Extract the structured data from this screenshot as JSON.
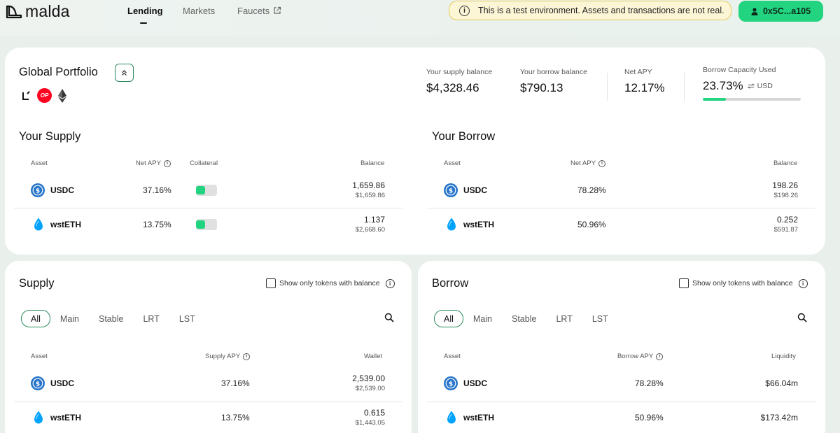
{
  "app": {
    "logo_text": "malda"
  },
  "nav": {
    "lending": "Lending",
    "markets": "Markets",
    "faucets": "Faucets"
  },
  "banner": {
    "text": "This is a test environment. Assets and transactions are not real."
  },
  "wallet": {
    "address": "0x5C...a105"
  },
  "portfolio": {
    "title": "Global Portfolio",
    "chains": [
      "linea-icon",
      "optimism-icon",
      "ethereum-icon"
    ],
    "op_label": "OP",
    "supply_balance_label": "Your supply balance",
    "supply_balance": "$4,328.46",
    "borrow_balance_label": "Your borrow balance",
    "borrow_balance": "$790.13",
    "net_apy_label": "Net APY",
    "net_apy": "12.17%",
    "capacity_label": "Borrow Capacity Used",
    "capacity_value": "23.73%",
    "capacity_unit": "USD",
    "capacity_fraction": 0.2373
  },
  "your_supply": {
    "title": "Your Supply",
    "headers": {
      "asset": "Asset",
      "net_apy": "Net APY",
      "collateral": "Collateral",
      "balance": "Balance"
    },
    "rows": [
      {
        "asset": "USDC",
        "apy": "37.16%",
        "collateral": true,
        "balance": "1,659.86",
        "balance_usd": "$1,659.86"
      },
      {
        "asset": "wstETH",
        "apy": "13.75%",
        "collateral": true,
        "balance": "1.137",
        "balance_usd": "$2,668.60"
      }
    ]
  },
  "your_borrow": {
    "title": "Your Borrow",
    "headers": {
      "asset": "Asset",
      "net_apy": "Net APY",
      "balance": "Balance"
    },
    "rows": [
      {
        "asset": "USDC",
        "apy": "78.28%",
        "balance": "198.26",
        "balance_usd": "$198.26"
      },
      {
        "asset": "wstETH",
        "apy": "50.96%",
        "balance": "0.252",
        "balance_usd": "$591.87"
      }
    ]
  },
  "supply_market": {
    "title": "Supply",
    "filter_label": "Show only tokens with balance",
    "tabs": [
      "All",
      "Main",
      "Stable",
      "LRT",
      "LST"
    ],
    "active_tab": "All",
    "headers": {
      "asset": "Asset",
      "apy": "Supply APY",
      "wallet": "Wallet"
    },
    "rows": [
      {
        "asset": "USDC",
        "apy": "37.16%",
        "wallet": "2,539.00",
        "wallet_usd": "$2,539.00"
      },
      {
        "asset": "wstETH",
        "apy": "13.75%",
        "wallet": "0.615",
        "wallet_usd": "$1,443.05"
      }
    ]
  },
  "borrow_market": {
    "title": "Borrow",
    "filter_label": "Show only tokens with balance",
    "tabs": [
      "All",
      "Main",
      "Stable",
      "LRT",
      "LST"
    ],
    "active_tab": "All",
    "headers": {
      "asset": "Asset",
      "apy": "Borrow APY",
      "liquidity": "Liquidity"
    },
    "rows": [
      {
        "asset": "USDC",
        "apy": "78.28%",
        "liquidity": "$66.04m"
      },
      {
        "asset": "wstETH",
        "apy": "50.96%",
        "liquidity": "$173.42m"
      }
    ]
  },
  "colors": {
    "accent": "#22d47f",
    "accent_dark": "#2c8a5e",
    "banner_bg": "#fdf6d6",
    "usdc": "#2775ca",
    "wsteth": "#00a3ff",
    "op_red": "#ff0420"
  }
}
